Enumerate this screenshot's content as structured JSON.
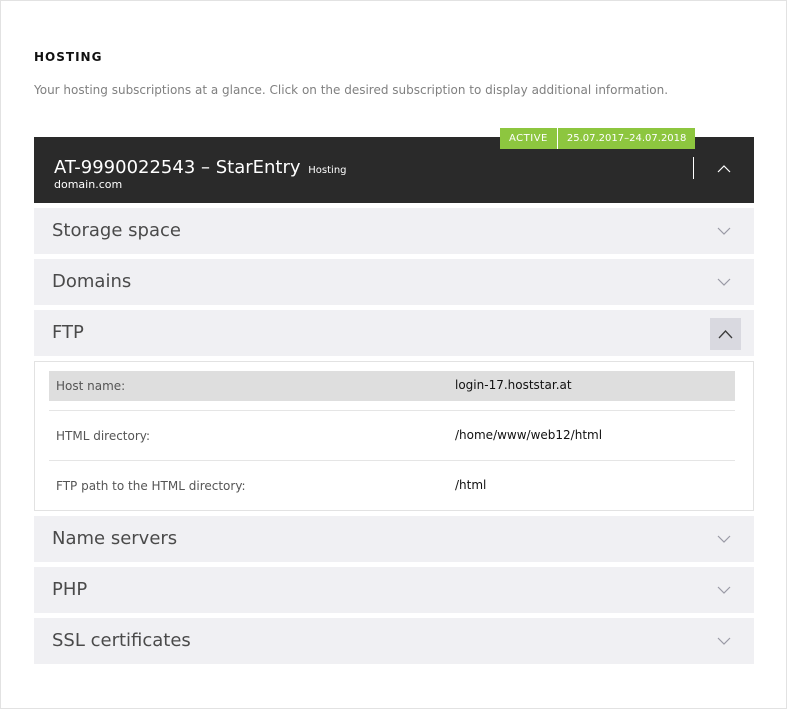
{
  "page": {
    "heading": "HOSTING",
    "intro": "Your hosting subscriptions at a glance. Click on the desired subscription to display additional information."
  },
  "subscription": {
    "id_title": "AT-9990022543 – StarEntry",
    "type": "Hosting",
    "domain": "domain.com",
    "status": "ACTIVE",
    "period": "25.07.2017–24.07.2018",
    "expanded": true,
    "status_color": "#8dc63f",
    "header_color": "#2a2a2a"
  },
  "sections": {
    "storage": {
      "label": "Storage space",
      "expanded": false
    },
    "domains": {
      "label": "Domains",
      "expanded": false
    },
    "ftp": {
      "label": "FTP",
      "expanded": true
    },
    "nameservers": {
      "label": "Name servers",
      "expanded": false
    },
    "php": {
      "label": "PHP",
      "expanded": false
    },
    "ssl": {
      "label": "SSL certificates",
      "expanded": false
    }
  },
  "ftp_rows": [
    {
      "key": "Host name:",
      "value": "login-17.hoststar.at"
    },
    {
      "key": "HTML directory:",
      "value": "/home/www/web12/html"
    },
    {
      "key": "FTP path to the HTML directory:",
      "value": "/html"
    }
  ],
  "icons": {
    "collapse": "chevron-up-icon",
    "expand": "chevron-down-icon"
  }
}
